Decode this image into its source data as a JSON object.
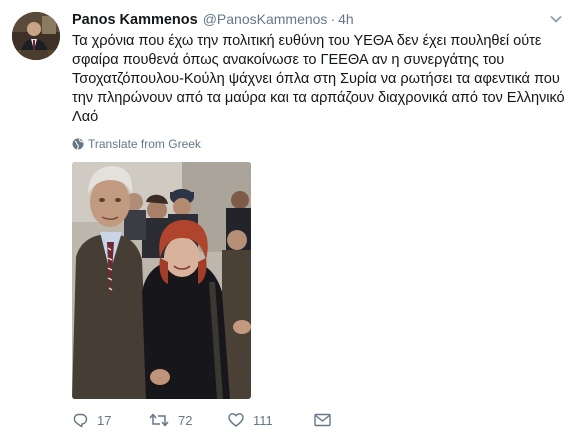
{
  "tweet": {
    "author_name": "Panos Kammenos",
    "handle": "@PanosKammenos",
    "separator": "·",
    "time": "4h",
    "text_lines": [
      "Τα χρόνια που έχω την πολιτική ευθύνη του ΥΕΘΑ δεν έχει πουληθεί ούτε",
      "σφαίρα πουθενά όπως ανακοίνωσε το ΓΕΕΘΑ αν η συνεργάτης του",
      "Τσοχατζόπουλου-Κούλη ψάχνει όπλα στη Συρία να ρωτήσει τα αφεντικά που",
      "την πληρώνουν από τα μαύρα και τα αρπάζουν διαχρονικά από τον Ελληνικό",
      "Λαό"
    ],
    "translate_label": "Translate from Greek"
  },
  "actions": {
    "reply_count": "17",
    "retweet_count": "72",
    "like_count": "111"
  },
  "icons": {
    "avatar": "avatar-photo",
    "caret": "chevron-down-icon",
    "translate": "globe-icon",
    "reply": "reply-icon",
    "retweet": "retweet-icon",
    "like": "heart-icon",
    "dm": "envelope-icon"
  },
  "colors": {
    "text": "#14171a",
    "muted": "#657786",
    "background": "#ffffff"
  }
}
